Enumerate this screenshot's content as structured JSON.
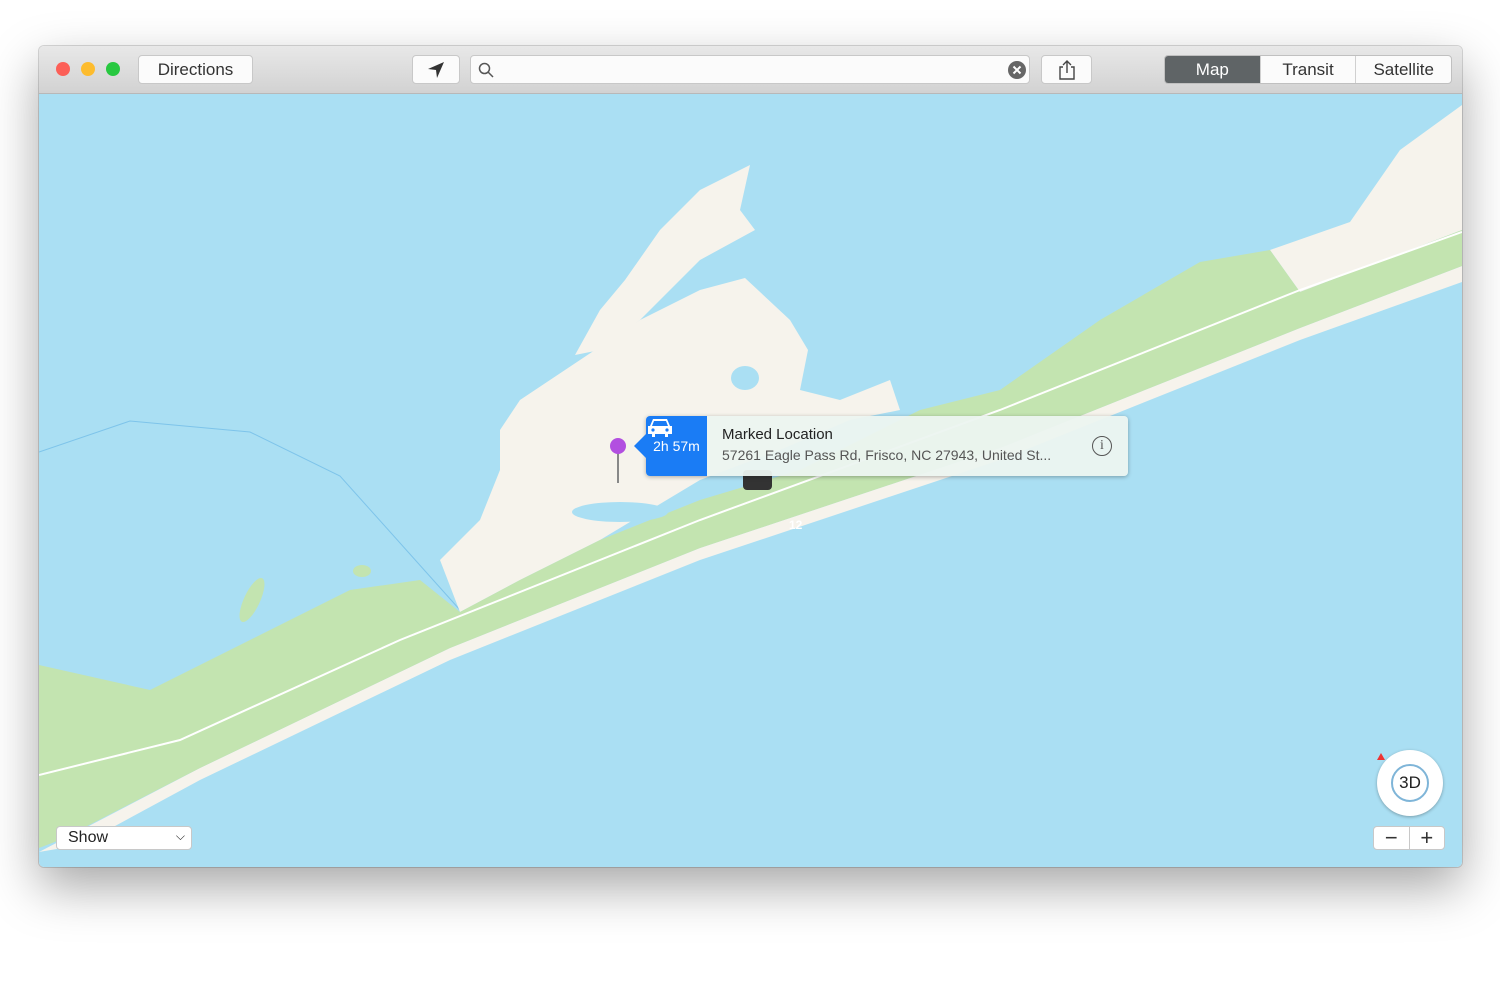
{
  "toolbar": {
    "directions_label": "Directions",
    "search_value": "",
    "segments": [
      {
        "label": "Map",
        "active": true
      },
      {
        "label": "Transit",
        "active": false
      },
      {
        "label": "Satellite",
        "active": false
      }
    ]
  },
  "callout": {
    "eta": "2h 57m",
    "title": "Marked Location",
    "address": "57261 Eagle Pass Rd, Frisco, NC  27943, United St...",
    "transport_icon": "car-icon"
  },
  "map": {
    "route_shield": "12",
    "show_label": "Show",
    "compass_label": "3D",
    "zoom_out": "−",
    "zoom_in": "+",
    "colors": {
      "water": "#aadff3",
      "land": "#f6f3ec",
      "park": "#c3e4b0",
      "pin": "#b24fe0",
      "eta": "#1a7cf5"
    }
  }
}
